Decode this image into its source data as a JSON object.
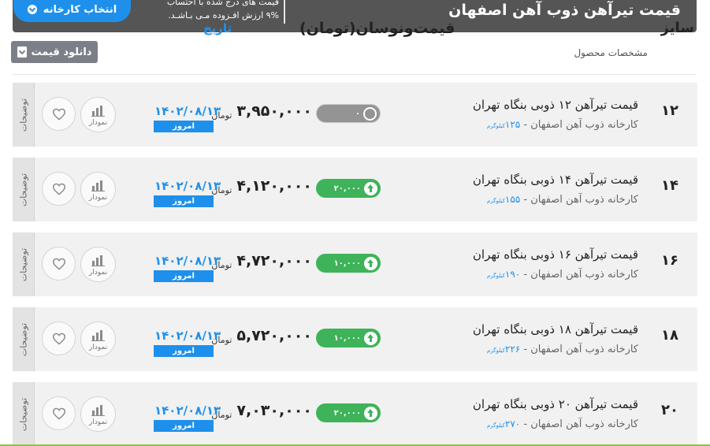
{
  "header": {
    "title": "قیمت تیرآهن ذوب آهن اصفهان",
    "note_line1": "قیمت های درج شده با احتساب",
    "note_line2": "۹% ارزش افـزوده مـی بـاشـد.",
    "factory_button": "انتخاب کارخانه"
  },
  "toolbar": {
    "download_label": "دانلود قیمت"
  },
  "columns": {
    "size": "سایز",
    "spec": "مشخصات محصول",
    "price": "قیمت‌ونوسان(تومان)",
    "date": "تاریخ"
  },
  "rows": [
    {
      "size": "۱۲",
      "name": "قیمت تیرآهن ۱۲ ذوبی بنگاه تهران",
      "sub": "کارخانه ذوب آهن اصفهان - ",
      "weight": "۱۲۵",
      "kg": "کیلوگرم",
      "price": "۳,۹۵۰,۰۰۰",
      "unit": "تومان",
      "change": "۰",
      "change_type": "neutral",
      "date": "۱۴۰۲/۰۸/۱۳",
      "today": "امروز",
      "chart_label": "نمودار",
      "side_label": "توضیحات"
    },
    {
      "size": "۱۴",
      "name": "قیمت تیرآهن ۱۴ ذوبی بنگاه تهران",
      "sub": "کارخانه ذوب آهن اصفهان - ",
      "weight": "۱۵۵",
      "kg": "کیلوگرم",
      "price": "۴,۱۲۰,۰۰۰",
      "unit": "تومان",
      "change": "۲۰,۰۰۰",
      "change_type": "up",
      "date": "۱۴۰۲/۰۸/۱۳",
      "today": "امروز",
      "chart_label": "نمودار",
      "side_label": "توضیحات"
    },
    {
      "size": "۱۶",
      "name": "قیمت تیرآهن ۱۶ ذوبی بنگاه تهران",
      "sub": "کارخانه ذوب آهن اصفهان - ",
      "weight": "۱۹۰",
      "kg": "کیلوگرم",
      "price": "۴,۷۲۰,۰۰۰",
      "unit": "تومان",
      "change": "۱۰,۰۰۰",
      "change_type": "up",
      "date": "۱۴۰۲/۰۸/۱۳",
      "today": "امروز",
      "chart_label": "نمودار",
      "side_label": "توضیحات"
    },
    {
      "size": "۱۸",
      "name": "قیمت تیرآهن ۱۸ ذوبی بنگاه تهران",
      "sub": "کارخانه ذوب آهن اصفهان - ",
      "weight": "۲۲۶",
      "kg": "کیلوگرم",
      "price": "۵,۷۲۰,۰۰۰",
      "unit": "تومان",
      "change": "۱۰,۰۰۰",
      "change_type": "up",
      "date": "۱۴۰۲/۰۸/۱۳",
      "today": "امروز",
      "chart_label": "نمودار",
      "side_label": "توضیحات"
    },
    {
      "size": "۲۰",
      "name": "قیمت تیرآهن ۲۰ ذوبی بنگاه تهران",
      "sub": "کارخانه ذوب آهن اصفهان - ",
      "weight": "۲۷۰",
      "kg": "کیلوگرم",
      "price": "۷,۰۳۰,۰۰۰",
      "unit": "تومان",
      "change": "۲۰,۰۰۰",
      "change_type": "up",
      "date": "۱۴۰۲/۰۸/۱۳",
      "today": "امروز",
      "chart_label": "نمودار",
      "side_label": "توضیحات"
    }
  ],
  "colors": {
    "header_bg": "#555555",
    "accent_blue": "#1e90ec",
    "up_green": "#3eb35a",
    "neutral_gray": "#949494",
    "row_bg": "#f1f1f1"
  },
  "icons": {
    "heart": "heart-icon",
    "chart": "bar-chart-icon",
    "download": "download-icon",
    "chevron": "chevron-down-icon",
    "up_arrow": "arrow-up-icon"
  }
}
